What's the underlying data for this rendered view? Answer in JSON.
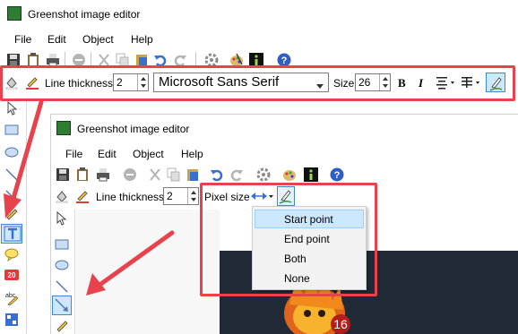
{
  "outer_window": {
    "title": "Greenshot image editor",
    "menu": [
      "File",
      "Edit",
      "Object",
      "Help"
    ],
    "line_thickness_label": "Line thickness",
    "line_thickness_value": "2",
    "font_name": "Microsoft Sans Serif",
    "size_label": "Size",
    "size_value": "26",
    "bold_label": "B",
    "italic_label": "I"
  },
  "inner_window": {
    "title": "Greenshot image editor",
    "menu": [
      "File",
      "Edit",
      "Object",
      "Help"
    ],
    "line_thickness_label": "Line thickness",
    "line_thickness_value": "2",
    "pixel_size_label": "Pixel size",
    "arrow_heads_menu": {
      "items": [
        "Start point",
        "End point",
        "Both",
        "None"
      ],
      "selected": "Start point"
    },
    "step_badge": "16"
  },
  "colors": {
    "highlight_red": "#e8434c",
    "menu_selected_bg": "#cce8ff",
    "menu_selected_border": "#99d1ff",
    "canvas_dark": "#1f2a36",
    "accent_blue": "#3b6fcf"
  }
}
